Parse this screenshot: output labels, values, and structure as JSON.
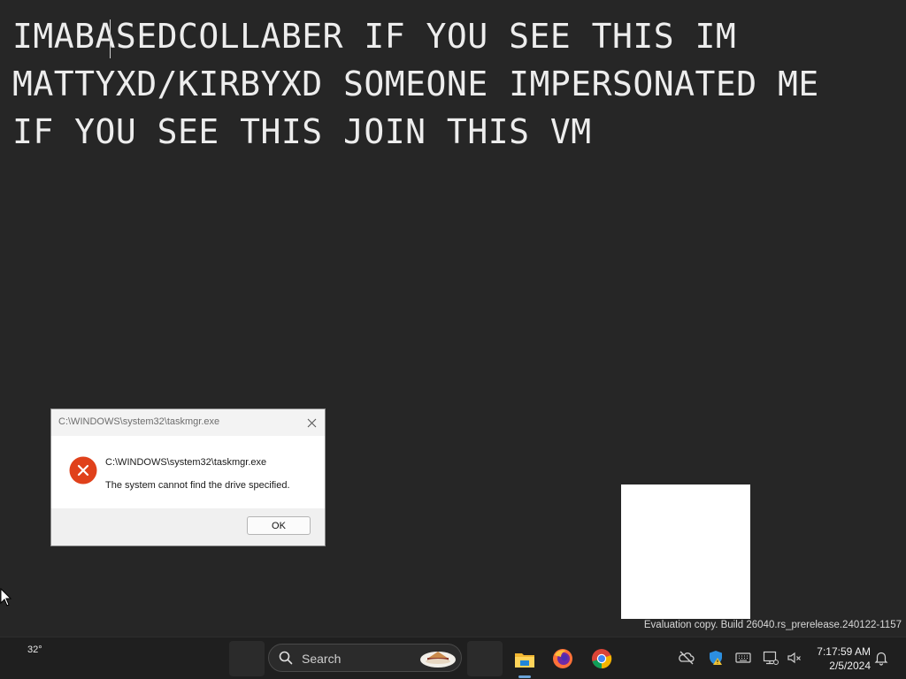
{
  "desktop": {
    "message_lines": [
      "IMABASEDCOLLABER IF YOU SEE THIS IM",
      "MATTYXD/KIRBYXD SOMEONE IMPERSONATED ME",
      "IF YOU SEE THIS JOIN THIS VM"
    ],
    "watermark": "Evaluation copy. Build 26040.rs_prerelease.240122-1157"
  },
  "dialog": {
    "title": "C:\\WINDOWS\\system32\\taskmgr.exe",
    "path": "C:\\WINDOWS\\system32\\taskmgr.exe",
    "message": "The system cannot find the drive specified.",
    "ok_label": "OK",
    "icon": "error-icon",
    "error_color": "#e0411b"
  },
  "taskbar": {
    "weather_temp": "32°",
    "search_placeholder": "Search",
    "apps": [
      "file-explorer-icon",
      "firefox-icon",
      "chrome-icon"
    ],
    "tray_icons": [
      "onedrive-offline-icon",
      "defender-warning-icon",
      "keyboard-icon",
      "network-icon",
      "volume-muted-icon",
      "notification-bell-icon"
    ],
    "time": "7:17:59 AM",
    "date": "2/5/2024",
    "accent_color": "#6aa3d8"
  }
}
